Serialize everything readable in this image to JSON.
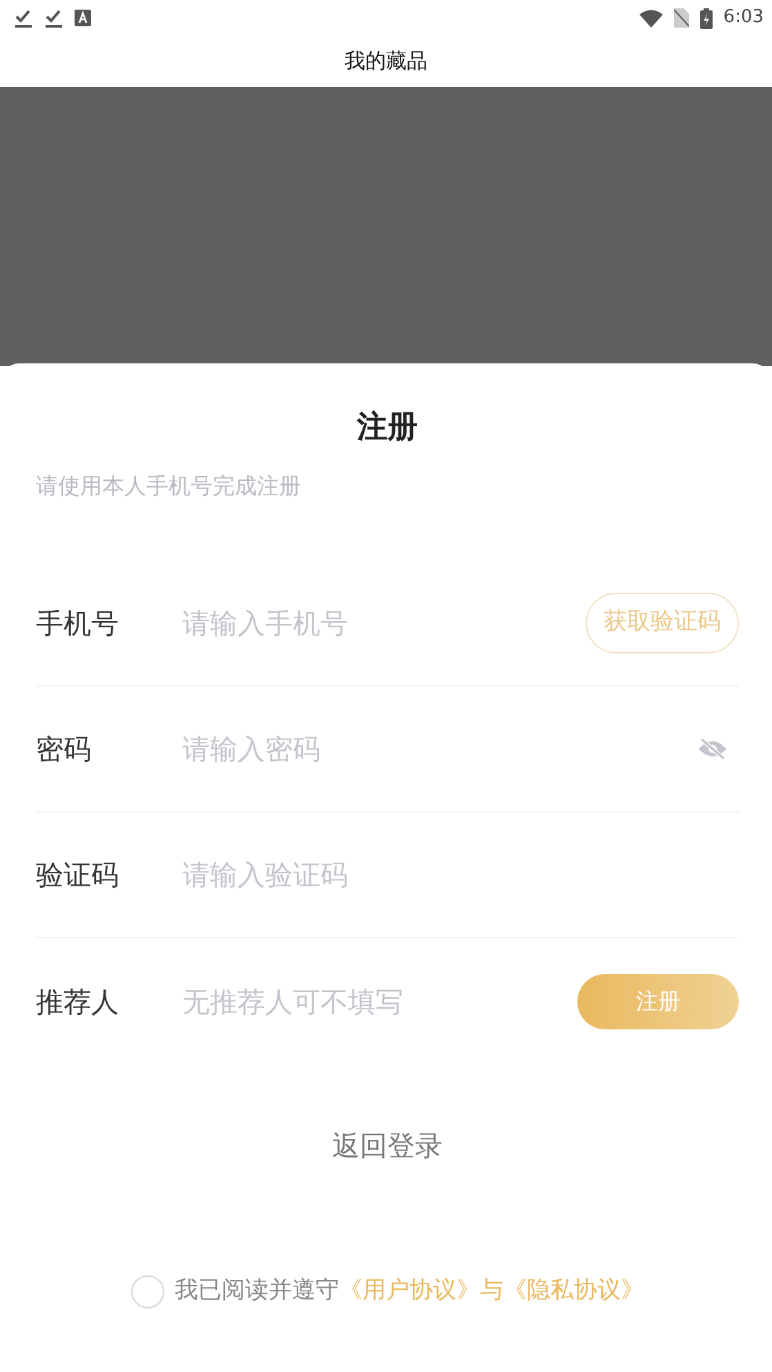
{
  "status_bar": {
    "time": "6:03"
  },
  "app_bar": {
    "title": "我的藏品"
  },
  "sheet": {
    "title": "注册",
    "subtitle": "请使用本人手机号完成注册",
    "fields": [
      {
        "kind": "code",
        "label": "手机号",
        "placeholder": "请输入手机号",
        "action": "获取验证码"
      },
      {
        "kind": "password",
        "label": "密码",
        "placeholder": "请输入密码",
        "password_visible": false
      },
      {
        "kind": "plain",
        "label": "验证码",
        "placeholder": "请输入验证码"
      },
      {
        "kind": "submit",
        "label": "推荐人",
        "placeholder": "无推荐人可不填写",
        "action": "注册"
      }
    ],
    "back_link": "返回登录",
    "agreement": {
      "checked": false,
      "text": "我已阅读并遵守",
      "link_1": "《用户协议》",
      "joiner": "与",
      "link_2": "《隐私协议》"
    }
  }
}
